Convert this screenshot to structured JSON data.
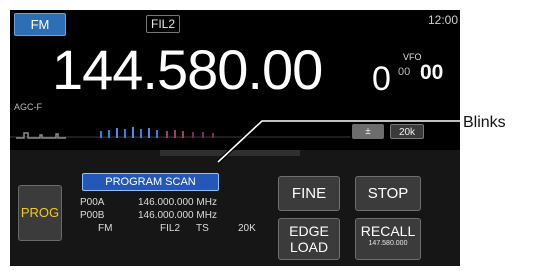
{
  "screen": {
    "mode": "FM",
    "filter": "FIL2",
    "clock": "12:00",
    "frequency": {
      "main": "144.580.00",
      "small": "0"
    },
    "vfo": {
      "label": "VFO",
      "small": "00",
      "big": "00"
    },
    "agc_label": "AGC-F",
    "scope": {
      "span_select": "±",
      "span_value": "20k"
    }
  },
  "scan_panel": {
    "prog_button": "PROG",
    "status_badge": "PROGRAM SCAN",
    "rows": [
      {
        "label": "P00A",
        "value": "146.000.000 MHz"
      },
      {
        "label": "P00B",
        "value": "146.000.000 MHz"
      }
    ],
    "footer": {
      "mode": "FM",
      "filter": "FIL2",
      "ts_label": "TS",
      "ts_value": "20K"
    },
    "buttons": {
      "fine": "FINE",
      "stop": "STOP",
      "edge_line1": "EDGE",
      "edge_line2": "LOAD",
      "recall": "RECALL",
      "recall_sub": "147.580.000"
    }
  },
  "callout": {
    "label": "Blinks"
  }
}
